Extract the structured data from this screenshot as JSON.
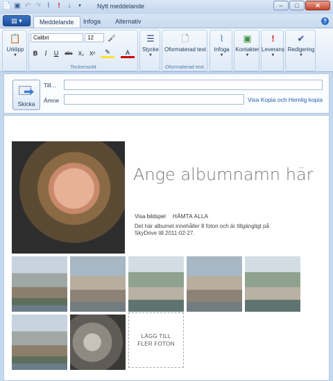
{
  "window": {
    "title": "Nytt meddelande"
  },
  "ribbon": {
    "app_button_label": "",
    "tabs": [
      {
        "label": "Meddelande"
      },
      {
        "label": "Infoga"
      },
      {
        "label": "Alternativ"
      }
    ],
    "groups": {
      "clipboard": {
        "button": "Urklipp"
      },
      "font": {
        "label": "Teckensnitt",
        "font_name": "Calibri",
        "font_size": "12",
        "buttons": [
          "B",
          "I",
          "U",
          "abc",
          "X₂",
          "X²"
        ]
      },
      "style": {
        "button": "Stycke"
      },
      "formatted": {
        "button": "Oformaterad text",
        "label": "Oformaterad text"
      },
      "attach": {
        "button": "Infoga"
      },
      "contacts": {
        "button": "Kontakter"
      },
      "delivery": {
        "button": "Leverans"
      },
      "editing": {
        "button": "Redigering"
      }
    }
  },
  "compose": {
    "send_label": "Skicka",
    "to_label": "Till...",
    "subject_label": "Ämne",
    "to_value": "",
    "subject_value": "",
    "cc_link": "Visa Kopia och Hemlig kopia"
  },
  "album": {
    "title": "Ange albumnamn här",
    "slideshow_link": "Visa bildspel",
    "download_link": "HÄMTA ALLA",
    "description": "Det här albumet innehåller 8 foton och är tillgängligt på SkyDrive till 2011-02-27.",
    "add_more": "LÄGG TILL FLER FOTON"
  },
  "colors": {
    "accent": "#1e5fb0",
    "ribbon": "#dde9f7",
    "title_text": "#777777"
  }
}
